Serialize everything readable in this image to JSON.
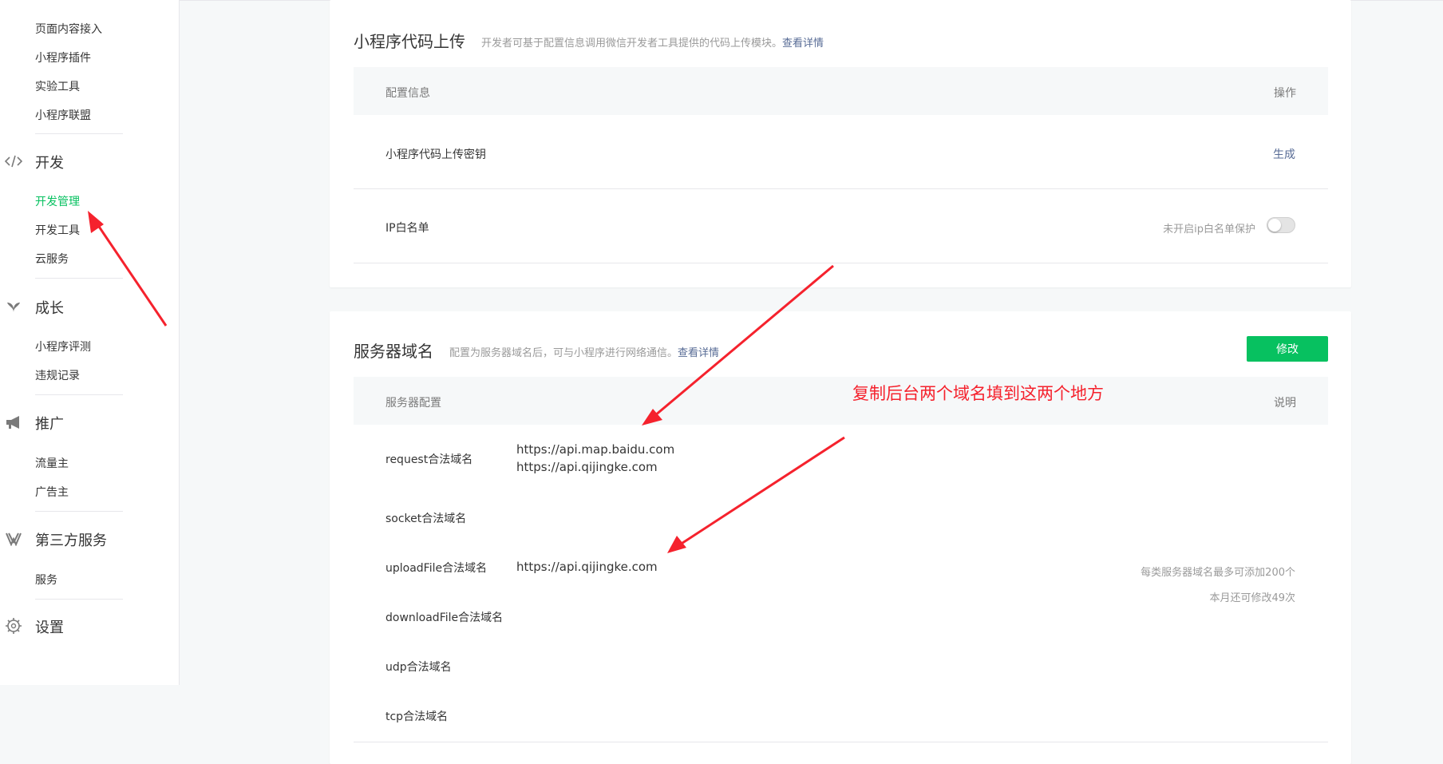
{
  "sidebar": {
    "items_top": [
      "页面内容接入",
      "小程序插件",
      "实验工具",
      "小程序联盟"
    ],
    "dev": {
      "label": "开发",
      "items": [
        "开发管理",
        "开发工具",
        "云服务"
      ]
    },
    "growth": {
      "label": "成长",
      "items": [
        "小程序评测",
        "违规记录"
      ]
    },
    "promo": {
      "label": "推广",
      "items": [
        "流量主",
        "广告主"
      ]
    },
    "thirdparty": {
      "label": "第三方服务",
      "items": [
        "服务"
      ]
    },
    "settings": {
      "label": "设置"
    }
  },
  "upload_panel": {
    "title": "小程序代码上传",
    "desc": "开发者可基于配置信息调用微信开发者工具提供的代码上传模块。",
    "desc_link": "查看详情",
    "col_config": "配置信息",
    "col_action": "操作",
    "row_secret_label": "小程序代码上传密钥",
    "row_secret_action": "生成",
    "row_ip_label": "IP白名单",
    "row_ip_status": "未开启ip白名单保护"
  },
  "domain_panel": {
    "title": "服务器域名",
    "desc": "配置为服务器域名后，可与小程序进行网络通信。",
    "desc_link": "查看详情",
    "edit_button": "修改",
    "col_config": "服务器配置",
    "col_note": "说明",
    "rows": {
      "request": {
        "label": "request合法域名",
        "values": [
          "https://api.map.baidu.com",
          "https://api.qijingke.com"
        ]
      },
      "socket": {
        "label": "socket合法域名"
      },
      "upload": {
        "label": "uploadFile合法域名",
        "values": [
          "https://api.qijingke.com"
        ]
      },
      "download": {
        "label": "downloadFile合法域名"
      },
      "udp": {
        "label": "udp合法域名"
      },
      "tcp": {
        "label": "tcp合法域名"
      }
    },
    "note_line1": "每类服务器域名最多可添加200个",
    "note_line2": "本月还可修改49次"
  },
  "annotation": {
    "text": "复制后台两个域名填到这两个地方",
    "color": "#f5222d"
  },
  "colors": {
    "accent": "#07c160",
    "link": "#576b95",
    "annotation": "#f5222d"
  },
  "icons": [
    "code-icon",
    "leaf-icon",
    "megaphone-icon",
    "third-party-icon",
    "gear-icon"
  ]
}
